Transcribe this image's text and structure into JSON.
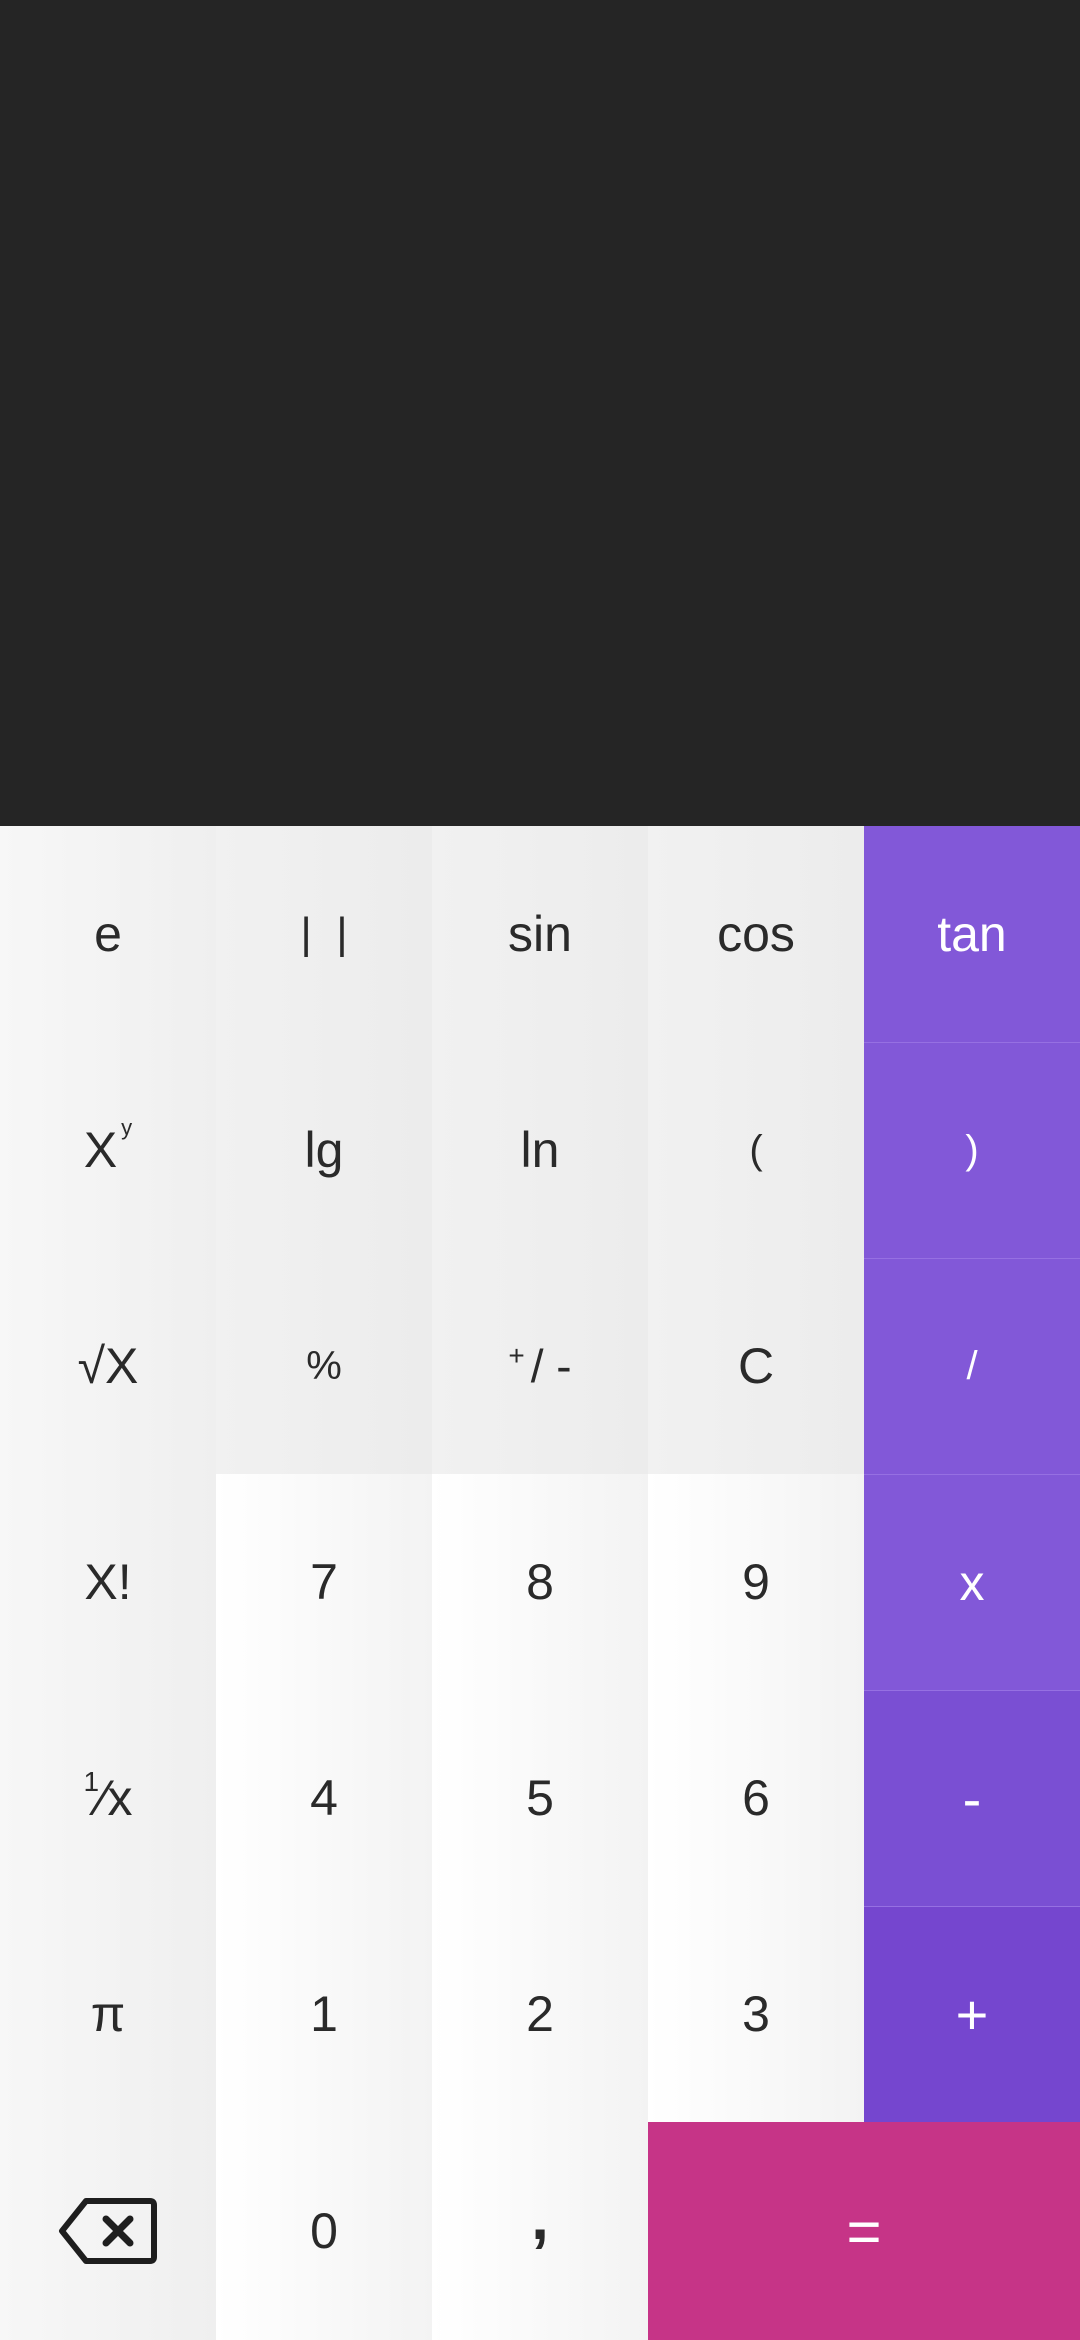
{
  "display": {
    "expression": "",
    "result": ""
  },
  "keys": {
    "e": "e",
    "abs": "|  |",
    "sin": "sin",
    "cos": "cos",
    "tan": "tan",
    "power_base": "X",
    "power_exp": "y",
    "lg": "lg",
    "ln": "ln",
    "open_paren": "(",
    "close_paren": ")",
    "sqrt": "√X",
    "percent": "%",
    "plus_minus_plus": "+",
    "plus_minus_rest": "/ -",
    "clear": "C",
    "divide": "/",
    "factorial": "X!",
    "seven": "7",
    "eight": "8",
    "nine": "9",
    "multiply": "x",
    "reciprocal_num": "1",
    "reciprocal_rest": "⁄x",
    "four": "4",
    "five": "5",
    "six": "6",
    "minus": "-",
    "pi": "π",
    "one": "1",
    "two": "2",
    "three": "3",
    "plus": "+",
    "backspace_icon": "backspace-icon",
    "zero": "0",
    "decimal": ",",
    "equals": "="
  },
  "colors": {
    "display_bg": "#252525",
    "operator_bg": "#8258d8",
    "equals_bg": "#c63487",
    "key_text": "#2a2a2a"
  }
}
